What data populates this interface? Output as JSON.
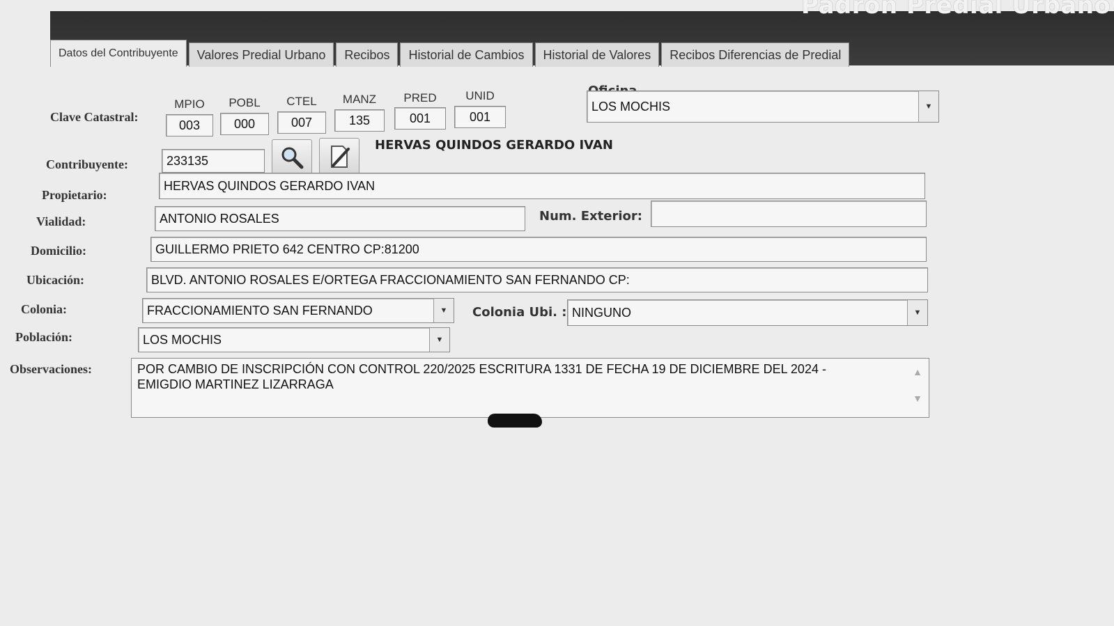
{
  "app": {
    "title": "Padron Predial Urbano"
  },
  "tabs": [
    {
      "label": "Datos del Contribuyente",
      "active": true
    },
    {
      "label": "Valores Predial Urbano",
      "active": false
    },
    {
      "label": "Recibos",
      "active": false
    },
    {
      "label": "Historial de Cambios",
      "active": false
    },
    {
      "label": "Historial de Valores",
      "active": false
    },
    {
      "label": "Recibos Diferencias de Predial",
      "active": false
    }
  ],
  "clave": {
    "label": "Clave Catastral:",
    "fields": [
      {
        "head": "MPIO",
        "value": "003"
      },
      {
        "head": "POBL",
        "value": "000"
      },
      {
        "head": "CTEL",
        "value": "007"
      },
      {
        "head": "MANZ",
        "value": "135"
      },
      {
        "head": "PRED",
        "value": "001"
      },
      {
        "head": "UNID",
        "value": "001"
      }
    ]
  },
  "oficina": {
    "label": "Oficina",
    "value": "LOS MOCHIS"
  },
  "contribuyente": {
    "label": "Contribuyente:",
    "value": "233135",
    "name": "HERVAS QUINDOS GERARDO IVAN"
  },
  "propietario": {
    "label": "Propietario:",
    "value": "HERVAS QUINDOS GERARDO IVAN"
  },
  "vialidad": {
    "label": "Vialidad:",
    "value": "ANTONIO ROSALES"
  },
  "num_exterior": {
    "label": "Num. Exterior:",
    "value": ""
  },
  "domicilio": {
    "label": "Domicilio:",
    "value": "GUILLERMO PRIETO  642 CENTRO CP:81200"
  },
  "ubicacion": {
    "label": "Ubicación:",
    "value": "BLVD. ANTONIO ROSALES E/ORTEGA  FRACCIONAMIENTO SAN FERNANDO CP:"
  },
  "colonia": {
    "label": "Colonia:",
    "value": "FRACCIONAMIENTO SAN FERNANDO"
  },
  "colonia_ubi": {
    "label": "Colonia Ubi. :",
    "value": "NINGUNO"
  },
  "poblacion": {
    "label": "Población:",
    "value": "LOS MOCHIS"
  },
  "observaciones": {
    "label": "Observaciones:",
    "line1": "POR CAMBIO DE INSCRIPCIÓN CON CONTROL 220/2025 ESCRITURA 1331 DE FECHA 19 DE DICIEMBRE DEL 2024 -",
    "line2": "EMIGDIO MARTINEZ LIZARRAGA"
  },
  "icons": {
    "search": "magnifier-icon",
    "edit": "pencil-icon",
    "dropdown": "chevron-down-icon"
  }
}
